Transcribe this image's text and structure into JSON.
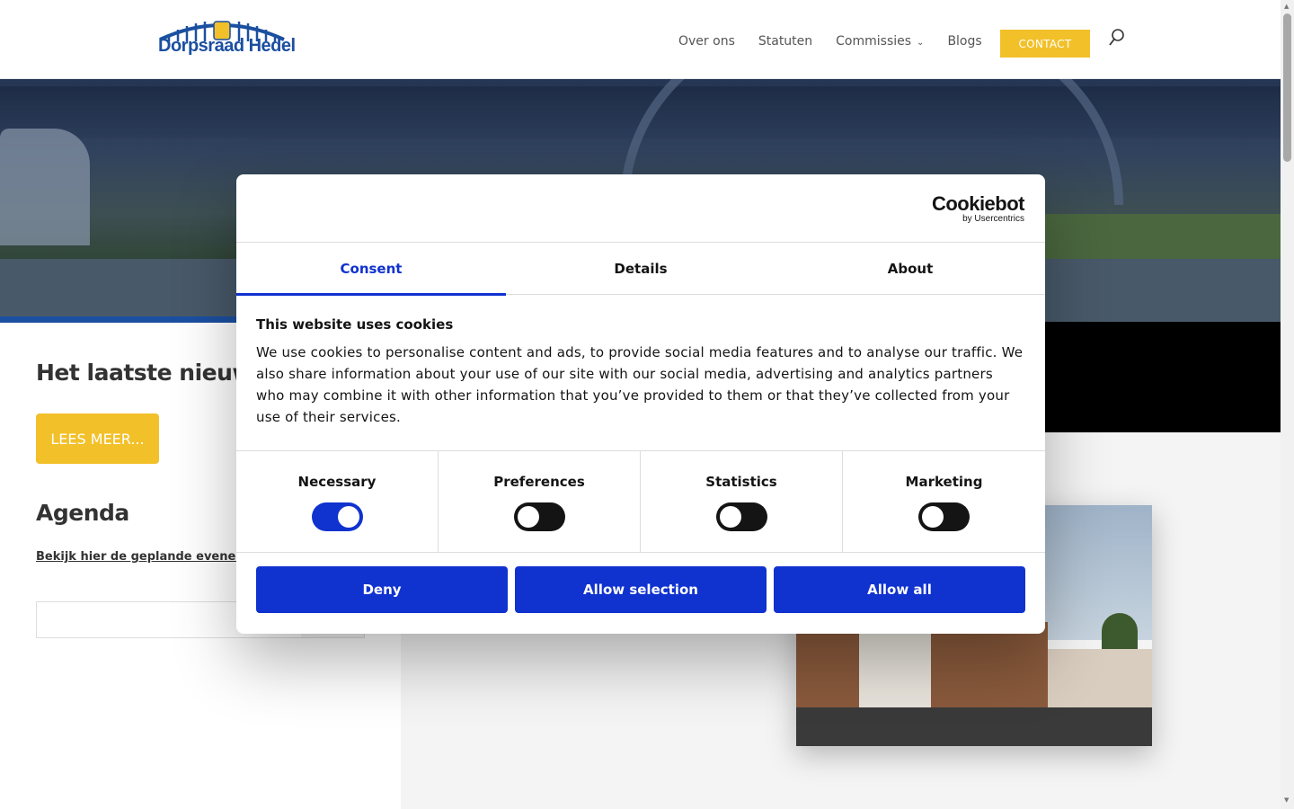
{
  "site": {
    "logo_text": "Dorpsraad Hedel",
    "nav": {
      "items": [
        "Over ons",
        "Statuten",
        "Commissies",
        "Blogs"
      ],
      "contact_label": "CONTACT"
    },
    "colors": {
      "brand_blue": "#1b4fa0",
      "accent_yellow": "#f2c029"
    }
  },
  "left": {
    "news_heading": "Het laatste nieuws",
    "read_more_label": "LEES MEER...",
    "agenda_heading": "Agenda",
    "agenda_link": "Bekijk hier de geplande evenem"
  },
  "cookie_dialog": {
    "brand": {
      "name": "Cookiebot",
      "sub": "by Usercentrics"
    },
    "tabs": [
      {
        "label": "Consent",
        "active": true
      },
      {
        "label": "Details",
        "active": false
      },
      {
        "label": "About",
        "active": false
      }
    ],
    "title": "This website uses cookies",
    "text": "We use cookies to personalise content and ads, to provide social media features and to analyse our traffic. We also share information about your use of our site with our social media, advertising and analytics partners who may combine it with other information that you’ve provided to them or that they’ve collected from your use of their services.",
    "categories": [
      {
        "label": "Necessary",
        "enabled": true
      },
      {
        "label": "Preferences",
        "enabled": false
      },
      {
        "label": "Statistics",
        "enabled": false
      },
      {
        "label": "Marketing",
        "enabled": false
      }
    ],
    "buttons": {
      "deny": "Deny",
      "allow_selection": "Allow selection",
      "allow_all": "Allow all"
    },
    "colors": {
      "primary": "#1032cf"
    }
  }
}
